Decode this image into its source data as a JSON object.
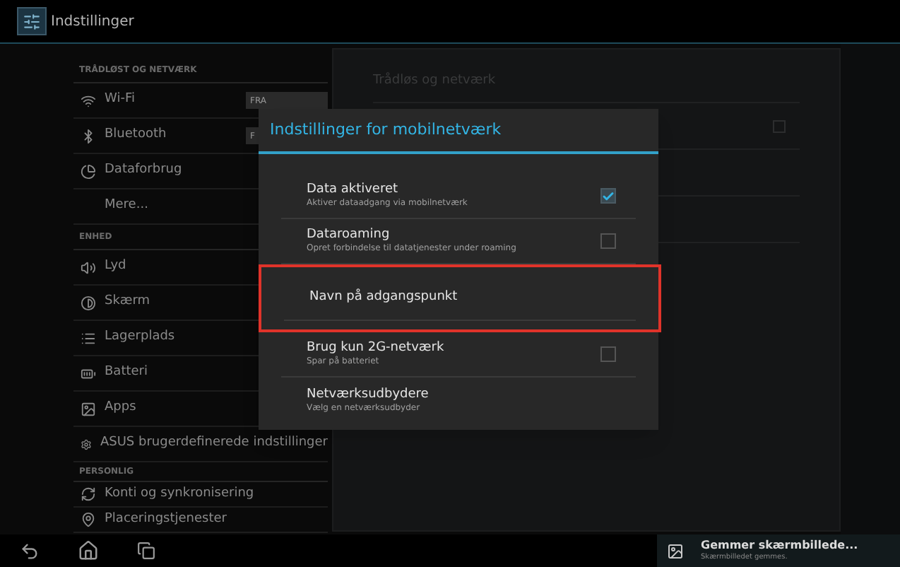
{
  "app_bar": {
    "title": "Indstillinger"
  },
  "sidebar": {
    "sections": [
      {
        "header": "TRÅDLØST OG NETVÆRK",
        "items": [
          {
            "label": "Wi-Fi",
            "toggle": "FRA",
            "on": false
          },
          {
            "label": "Bluetooth",
            "toggle": "F",
            "on": false
          },
          {
            "label": "Dataforbrug"
          },
          {
            "label": "Mere..."
          }
        ]
      },
      {
        "header": "ENHED",
        "items": [
          {
            "label": "Lyd"
          },
          {
            "label": "Skærm"
          },
          {
            "label": "Lagerplads"
          },
          {
            "label": "Batteri"
          },
          {
            "label": "Apps"
          },
          {
            "label": "ASUS brugerdefinerede indstillinger"
          }
        ]
      },
      {
        "header": "PERSONLIG",
        "items": [
          {
            "label": "Konti og synkronisering"
          },
          {
            "label": "Placeringstjenester"
          }
        ]
      }
    ]
  },
  "detail_pane": {
    "title": "Trådløs og netværk",
    "rows": [
      {
        "kind": "checkbox",
        "checked": false
      },
      {
        "kind": "blank"
      },
      {
        "kind": "blank"
      }
    ]
  },
  "dialog": {
    "title": "Indstillinger for mobilnetværk",
    "items": [
      {
        "kind": "checkbox",
        "title": "Data aktiveret",
        "summary": "Aktiver dataadgang via mobilnetværk",
        "checked": true,
        "highlighted": false
      },
      {
        "kind": "checkbox",
        "title": "Dataroaming",
        "summary": "Opret forbindelse til datatjenester under roaming",
        "checked": false,
        "highlighted": false
      },
      {
        "kind": "plain",
        "title": "Navn på adgangspunkt",
        "highlighted": true
      },
      {
        "kind": "checkbox",
        "title": "Brug kun 2G-netværk",
        "summary": "Spar på batteriet",
        "checked": false,
        "highlighted": false
      },
      {
        "kind": "plain",
        "title": "Netværksudbydere",
        "summary": "Vælg en netværksudbyder",
        "highlighted": false
      }
    ]
  },
  "notification": {
    "title": "Gemmer skærmbillede...",
    "text": "Skærmbilledet gemmes."
  }
}
